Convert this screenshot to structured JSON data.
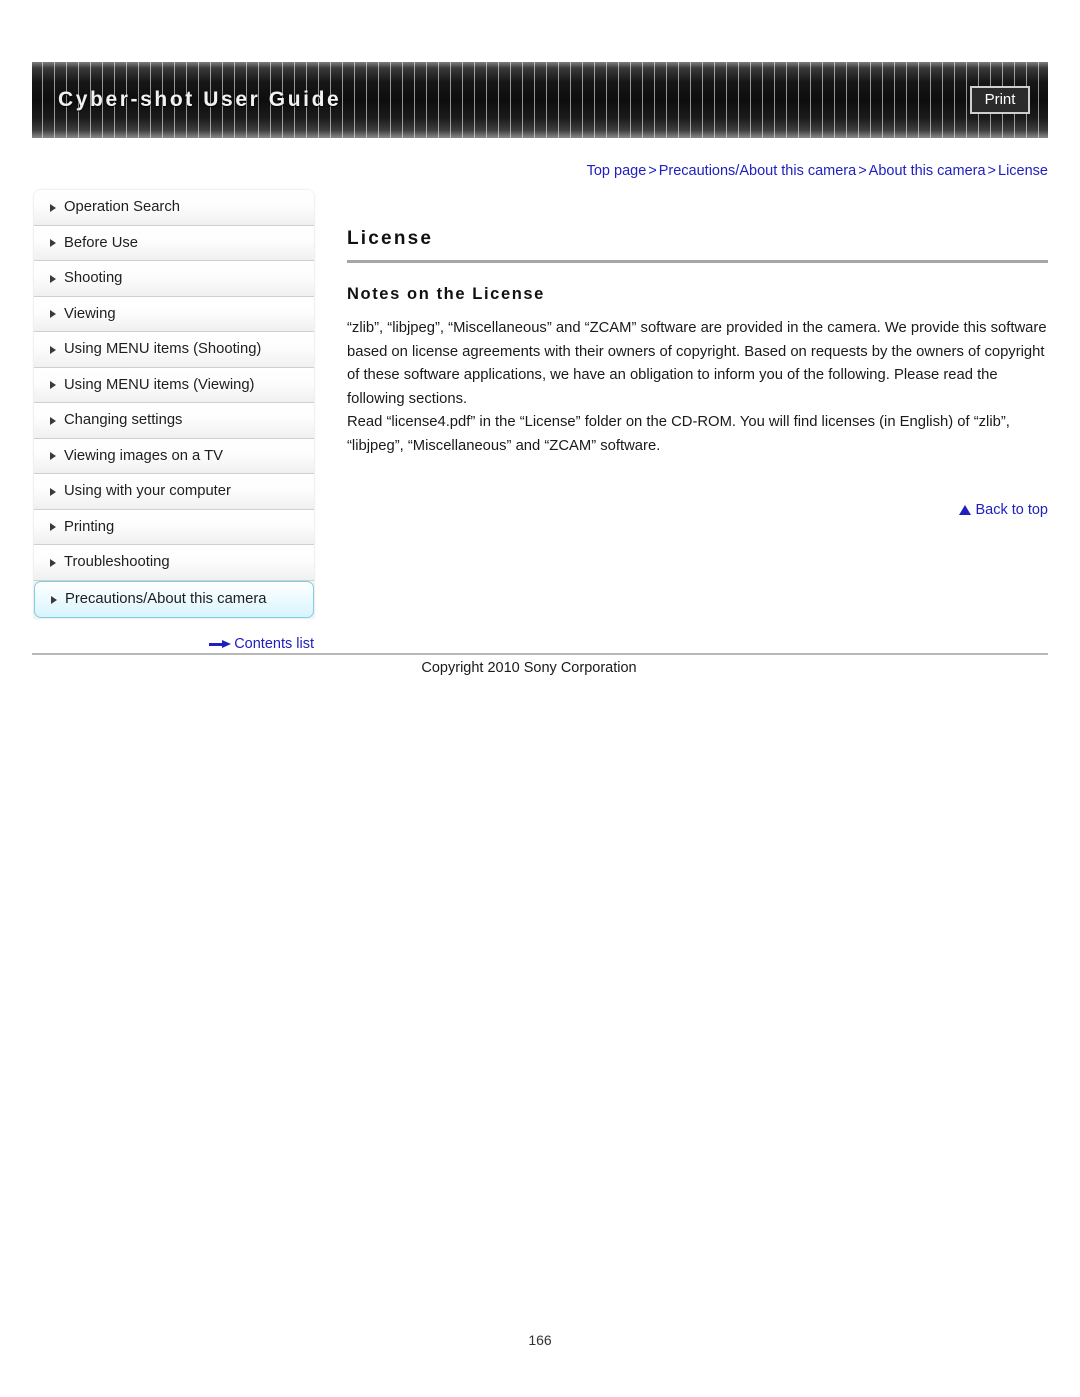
{
  "header": {
    "title": "Cyber-shot User Guide",
    "print_label": "Print"
  },
  "breadcrumb": {
    "items": [
      "Top page",
      "Precautions/About this camera",
      "About this camera",
      "License"
    ],
    "separator": ">",
    "full_text": "Top page > Precautions/About this camera > About this camera > License",
    "link_color": "#2020c0"
  },
  "sidebar": {
    "items": [
      {
        "label": "Operation Search",
        "active": false
      },
      {
        "label": "Before Use",
        "active": false
      },
      {
        "label": "Shooting",
        "active": false
      },
      {
        "label": "Viewing",
        "active": false
      },
      {
        "label": "Using MENU items (Shooting)",
        "active": false
      },
      {
        "label": "Using MENU items (Viewing)",
        "active": false
      },
      {
        "label": "Changing settings",
        "active": false
      },
      {
        "label": "Viewing images on a TV",
        "active": false
      },
      {
        "label": "Using with your computer",
        "active": false
      },
      {
        "label": "Printing",
        "active": false
      },
      {
        "label": "Troubleshooting",
        "active": false
      },
      {
        "label": "Precautions/About this camera",
        "active": true
      }
    ],
    "contents_link": "Contents list",
    "active_highlight_color": "#7ecfe0"
  },
  "main": {
    "title": "License",
    "section_heading": "Notes on the License",
    "paragraph_1": "“zlib”, “libjpeg”, “Miscellaneous” and “ZCAM” software are provided in the camera. We provide this software based on license agreements with their owners of copyright. Based on requests by the owners of copyright of these software applications, we have an obligation to inform you of the following. Please read the following sections.",
    "paragraph_2": "Read “license4.pdf” in the “License” folder on the CD-ROM. You will find licenses (in English) of “zlib”, “libjpeg”, “Miscellaneous” and “ZCAM” software.",
    "back_to_top": "Back to top"
  },
  "footer": {
    "copyright": "Copyright 2010 Sony Corporation",
    "page_number": "166"
  }
}
